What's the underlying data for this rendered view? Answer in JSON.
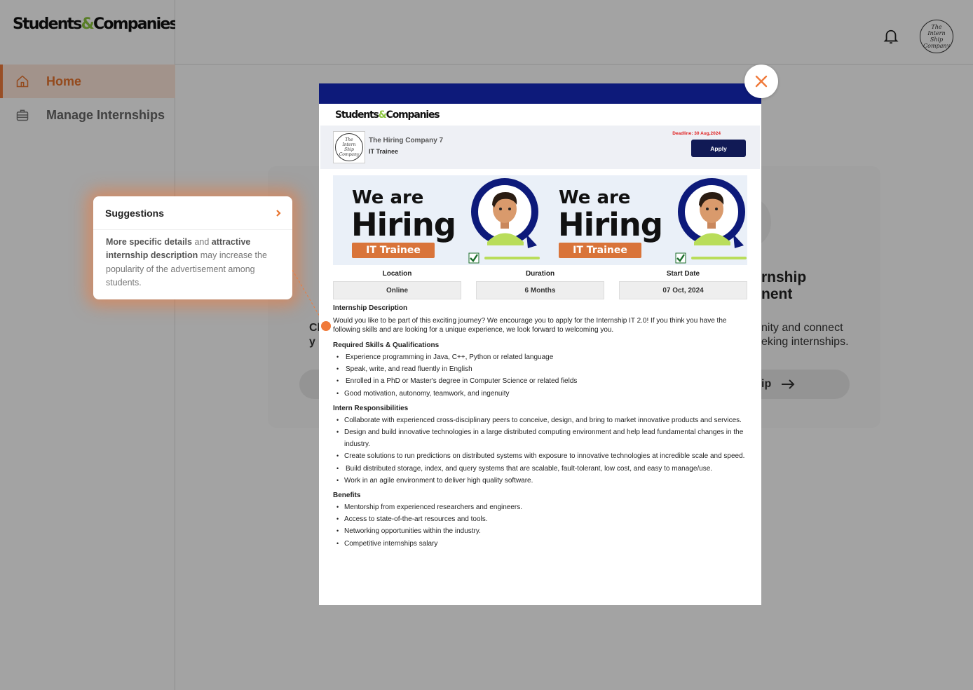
{
  "app": {
    "logo_text_1": "Students",
    "logo_amp": "&",
    "logo_text_2": "Companies"
  },
  "sidebar": {
    "items": [
      {
        "label": "Home",
        "icon": "home-icon",
        "active": true
      },
      {
        "label": "Manage Internships",
        "icon": "briefcase-icon",
        "active": false
      }
    ]
  },
  "header": {
    "bell_icon": "bell-icon",
    "avatar_text": "The Intern Ship Company"
  },
  "background": {
    "title_line1": "rnship",
    "title_line2": "nent",
    "desc_line1": "nity and connect",
    "desc_line2": "eking internships.",
    "left_line1": "Cl",
    "left_line2": "y",
    "button_partial": "ip"
  },
  "suggestions": {
    "title": "Suggestions",
    "bold1": "More specific details",
    "text1": " and ",
    "bold2": "attractive internship description",
    "text2": " may increase the popularity of the advertisement among students."
  },
  "modal": {
    "logo_text_1": "Students",
    "logo_amp": "&",
    "logo_text_2": "Companies",
    "company_name": "The Hiring Company 7",
    "role": "IT Trainee",
    "deadline": "Deadline: 30 Aug,2024",
    "apply_label": "Apply",
    "banner": {
      "we_are": "We are",
      "hiring": "Hiring",
      "tag": "IT Trainee"
    },
    "info": [
      {
        "label": "Location",
        "value": "Online"
      },
      {
        "label": "Duration",
        "value": "6 Months"
      },
      {
        "label": "Start Date",
        "value": "07 Oct, 2024"
      }
    ],
    "description_title": "Internship Description",
    "description": "Would you like to be part of this exciting journey? We encourage you to apply for the Internship IT 2.0! If you think you have the following skills and are looking for a unique experience, we look forward to welcoming you.",
    "skills_title": "Required Skills & Qualifications",
    "skills": [
      "Experience programming in Java, C++, Python or related language",
      "Speak, write, and read fluently in English",
      "Enrolled in a PhD or Master's degree in Computer Science or related fields",
      "Good motivation, autonomy, teamwork, and ingenuity"
    ],
    "responsibilities_title": "Intern Responsibilities",
    "responsibilities": [
      "Collaborate with experienced cross-disciplinary peers to conceive, design, and bring to market innovative products and services.",
      "Design and build innovative technologies in a large distributed computing environment and help lead fundamental changes in the industry.",
      "Create solutions to run predictions on distributed systems with exposure to innovative technologies at incredible scale and speed.",
      "Build distributed storage, index, and query systems that are scalable, fault-tolerant, low cost, and easy to manage/use.",
      "Work in an agile environment to deliver high quality software."
    ],
    "benefits_title": "Benefits",
    "benefits": [
      "Mentorship from experienced researchers and engineers.",
      "Access to state-of-the-art resources and tools.",
      "Networking opportunities within the industry.",
      "Competitive internships salary"
    ]
  },
  "colors": {
    "accent": "#f07a3a",
    "modal_bar": "#0d1a7a",
    "apply_button": "#111a55",
    "deadline": "#e02020",
    "logo_amp": "#8cc63f"
  }
}
